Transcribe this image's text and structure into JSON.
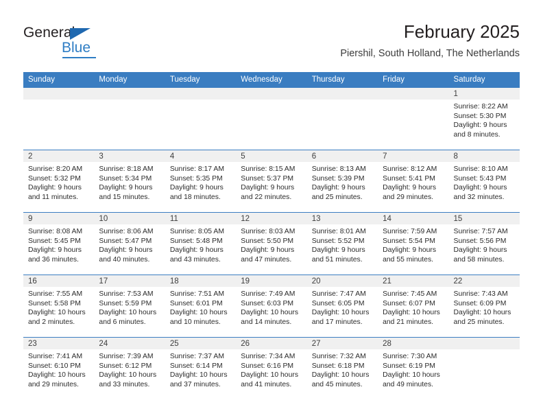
{
  "brand": {
    "name_top": "General",
    "name_bottom": "Blue",
    "accent_color": "#2e7dc4",
    "triangle_color": "#1f68b0"
  },
  "header": {
    "title": "February 2025",
    "subtitle": "Piershil, South Holland, The Netherlands"
  },
  "theme": {
    "header_row_bg": "#3a7dc1",
    "daynum_bg": "#f0f0f0",
    "cell_bg": "#ffffff",
    "text_color": "#2b2b2b"
  },
  "weekdays": [
    "Sunday",
    "Monday",
    "Tuesday",
    "Wednesday",
    "Thursday",
    "Friday",
    "Saturday"
  ],
  "weeks": [
    [
      {
        "day": "",
        "empty": true,
        "sunrise": "",
        "sunset": "",
        "daylight_1": "",
        "daylight_2": ""
      },
      {
        "day": "",
        "empty": true,
        "sunrise": "",
        "sunset": "",
        "daylight_1": "",
        "daylight_2": ""
      },
      {
        "day": "",
        "empty": true,
        "sunrise": "",
        "sunset": "",
        "daylight_1": "",
        "daylight_2": ""
      },
      {
        "day": "",
        "empty": true,
        "sunrise": "",
        "sunset": "",
        "daylight_1": "",
        "daylight_2": ""
      },
      {
        "day": "",
        "empty": true,
        "sunrise": "",
        "sunset": "",
        "daylight_1": "",
        "daylight_2": ""
      },
      {
        "day": "",
        "empty": true,
        "sunrise": "",
        "sunset": "",
        "daylight_1": "",
        "daylight_2": ""
      },
      {
        "day": "1",
        "empty": false,
        "sunrise": "Sunrise: 8:22 AM",
        "sunset": "Sunset: 5:30 PM",
        "daylight_1": "Daylight: 9 hours",
        "daylight_2": "and 8 minutes."
      }
    ],
    [
      {
        "day": "2",
        "empty": false,
        "sunrise": "Sunrise: 8:20 AM",
        "sunset": "Sunset: 5:32 PM",
        "daylight_1": "Daylight: 9 hours",
        "daylight_2": "and 11 minutes."
      },
      {
        "day": "3",
        "empty": false,
        "sunrise": "Sunrise: 8:18 AM",
        "sunset": "Sunset: 5:34 PM",
        "daylight_1": "Daylight: 9 hours",
        "daylight_2": "and 15 minutes."
      },
      {
        "day": "4",
        "empty": false,
        "sunrise": "Sunrise: 8:17 AM",
        "sunset": "Sunset: 5:35 PM",
        "daylight_1": "Daylight: 9 hours",
        "daylight_2": "and 18 minutes."
      },
      {
        "day": "5",
        "empty": false,
        "sunrise": "Sunrise: 8:15 AM",
        "sunset": "Sunset: 5:37 PM",
        "daylight_1": "Daylight: 9 hours",
        "daylight_2": "and 22 minutes."
      },
      {
        "day": "6",
        "empty": false,
        "sunrise": "Sunrise: 8:13 AM",
        "sunset": "Sunset: 5:39 PM",
        "daylight_1": "Daylight: 9 hours",
        "daylight_2": "and 25 minutes."
      },
      {
        "day": "7",
        "empty": false,
        "sunrise": "Sunrise: 8:12 AM",
        "sunset": "Sunset: 5:41 PM",
        "daylight_1": "Daylight: 9 hours",
        "daylight_2": "and 29 minutes."
      },
      {
        "day": "8",
        "empty": false,
        "sunrise": "Sunrise: 8:10 AM",
        "sunset": "Sunset: 5:43 PM",
        "daylight_1": "Daylight: 9 hours",
        "daylight_2": "and 32 minutes."
      }
    ],
    [
      {
        "day": "9",
        "empty": false,
        "sunrise": "Sunrise: 8:08 AM",
        "sunset": "Sunset: 5:45 PM",
        "daylight_1": "Daylight: 9 hours",
        "daylight_2": "and 36 minutes."
      },
      {
        "day": "10",
        "empty": false,
        "sunrise": "Sunrise: 8:06 AM",
        "sunset": "Sunset: 5:47 PM",
        "daylight_1": "Daylight: 9 hours",
        "daylight_2": "and 40 minutes."
      },
      {
        "day": "11",
        "empty": false,
        "sunrise": "Sunrise: 8:05 AM",
        "sunset": "Sunset: 5:48 PM",
        "daylight_1": "Daylight: 9 hours",
        "daylight_2": "and 43 minutes."
      },
      {
        "day": "12",
        "empty": false,
        "sunrise": "Sunrise: 8:03 AM",
        "sunset": "Sunset: 5:50 PM",
        "daylight_1": "Daylight: 9 hours",
        "daylight_2": "and 47 minutes."
      },
      {
        "day": "13",
        "empty": false,
        "sunrise": "Sunrise: 8:01 AM",
        "sunset": "Sunset: 5:52 PM",
        "daylight_1": "Daylight: 9 hours",
        "daylight_2": "and 51 minutes."
      },
      {
        "day": "14",
        "empty": false,
        "sunrise": "Sunrise: 7:59 AM",
        "sunset": "Sunset: 5:54 PM",
        "daylight_1": "Daylight: 9 hours",
        "daylight_2": "and 55 minutes."
      },
      {
        "day": "15",
        "empty": false,
        "sunrise": "Sunrise: 7:57 AM",
        "sunset": "Sunset: 5:56 PM",
        "daylight_1": "Daylight: 9 hours",
        "daylight_2": "and 58 minutes."
      }
    ],
    [
      {
        "day": "16",
        "empty": false,
        "sunrise": "Sunrise: 7:55 AM",
        "sunset": "Sunset: 5:58 PM",
        "daylight_1": "Daylight: 10 hours",
        "daylight_2": "and 2 minutes."
      },
      {
        "day": "17",
        "empty": false,
        "sunrise": "Sunrise: 7:53 AM",
        "sunset": "Sunset: 5:59 PM",
        "daylight_1": "Daylight: 10 hours",
        "daylight_2": "and 6 minutes."
      },
      {
        "day": "18",
        "empty": false,
        "sunrise": "Sunrise: 7:51 AM",
        "sunset": "Sunset: 6:01 PM",
        "daylight_1": "Daylight: 10 hours",
        "daylight_2": "and 10 minutes."
      },
      {
        "day": "19",
        "empty": false,
        "sunrise": "Sunrise: 7:49 AM",
        "sunset": "Sunset: 6:03 PM",
        "daylight_1": "Daylight: 10 hours",
        "daylight_2": "and 14 minutes."
      },
      {
        "day": "20",
        "empty": false,
        "sunrise": "Sunrise: 7:47 AM",
        "sunset": "Sunset: 6:05 PM",
        "daylight_1": "Daylight: 10 hours",
        "daylight_2": "and 17 minutes."
      },
      {
        "day": "21",
        "empty": false,
        "sunrise": "Sunrise: 7:45 AM",
        "sunset": "Sunset: 6:07 PM",
        "daylight_1": "Daylight: 10 hours",
        "daylight_2": "and 21 minutes."
      },
      {
        "day": "22",
        "empty": false,
        "sunrise": "Sunrise: 7:43 AM",
        "sunset": "Sunset: 6:09 PM",
        "daylight_1": "Daylight: 10 hours",
        "daylight_2": "and 25 minutes."
      }
    ],
    [
      {
        "day": "23",
        "empty": false,
        "sunrise": "Sunrise: 7:41 AM",
        "sunset": "Sunset: 6:10 PM",
        "daylight_1": "Daylight: 10 hours",
        "daylight_2": "and 29 minutes."
      },
      {
        "day": "24",
        "empty": false,
        "sunrise": "Sunrise: 7:39 AM",
        "sunset": "Sunset: 6:12 PM",
        "daylight_1": "Daylight: 10 hours",
        "daylight_2": "and 33 minutes."
      },
      {
        "day": "25",
        "empty": false,
        "sunrise": "Sunrise: 7:37 AM",
        "sunset": "Sunset: 6:14 PM",
        "daylight_1": "Daylight: 10 hours",
        "daylight_2": "and 37 minutes."
      },
      {
        "day": "26",
        "empty": false,
        "sunrise": "Sunrise: 7:34 AM",
        "sunset": "Sunset: 6:16 PM",
        "daylight_1": "Daylight: 10 hours",
        "daylight_2": "and 41 minutes."
      },
      {
        "day": "27",
        "empty": false,
        "sunrise": "Sunrise: 7:32 AM",
        "sunset": "Sunset: 6:18 PM",
        "daylight_1": "Daylight: 10 hours",
        "daylight_2": "and 45 minutes."
      },
      {
        "day": "28",
        "empty": false,
        "sunrise": "Sunrise: 7:30 AM",
        "sunset": "Sunset: 6:19 PM",
        "daylight_1": "Daylight: 10 hours",
        "daylight_2": "and 49 minutes."
      },
      {
        "day": "",
        "empty": true,
        "sunrise": "",
        "sunset": "",
        "daylight_1": "",
        "daylight_2": ""
      }
    ]
  ]
}
